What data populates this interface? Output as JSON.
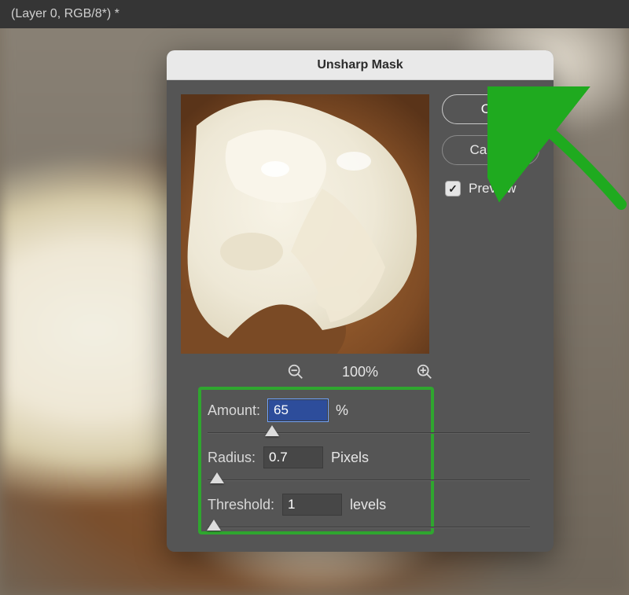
{
  "topbar": {
    "doc_title": "(Layer 0, RGB/8*) *"
  },
  "dialog": {
    "title": "Unsharp Mask",
    "ok_label": "OK",
    "cancel_label": "Cancel",
    "preview_label": "Preview",
    "preview_checked": true,
    "zoom_pct": "100%",
    "amount": {
      "label": "Amount:",
      "value": "65",
      "unit": "%",
      "slider_pct": 20
    },
    "radius": {
      "label": "Radius:",
      "value": "0.7",
      "unit": "Pixels",
      "slider_pct": 3
    },
    "threshold": {
      "label": "Threshold:",
      "value": "1",
      "unit": "levels",
      "slider_pct": 2
    }
  }
}
